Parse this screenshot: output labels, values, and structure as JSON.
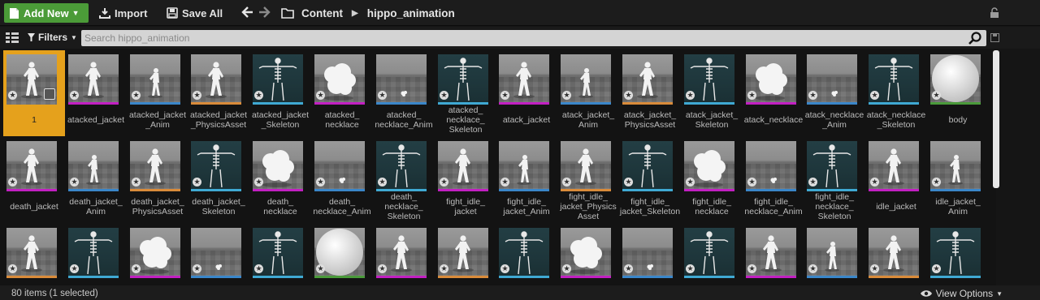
{
  "toolbar": {
    "add_new_label": "Add New",
    "import_label": "Import",
    "save_all_label": "Save All"
  },
  "breadcrumb": [
    "Content",
    "hippo_animation"
  ],
  "filterbar": {
    "filters_label": "Filters",
    "search_placeholder": "Search hippo_animation"
  },
  "assets": [
    {
      "label": "1",
      "kind": "pose",
      "stripe": "",
      "selected": true
    },
    {
      "label": "atacked_jacket",
      "kind": "pose",
      "stripe": "#c21fc2"
    },
    {
      "label": "atacked_jacket _Anim",
      "kind": "pose-small",
      "stripe": "#3a86c9"
    },
    {
      "label": "atacked_jacket _PhysicsAsset",
      "kind": "pose",
      "stripe": "#d98b3a"
    },
    {
      "label": "atacked_jacket _Skeleton",
      "kind": "skel",
      "stripe": "#3fa9d3"
    },
    {
      "label": "atacked_ necklace",
      "kind": "blob",
      "stripe": "#c21fc2"
    },
    {
      "label": "atacked_ necklace_Anim",
      "kind": "tiny",
      "stripe": "#3a86c9"
    },
    {
      "label": "atacked_ necklace_ Skeleton",
      "kind": "skel",
      "stripe": "#3fa9d3"
    },
    {
      "label": "atack_jacket",
      "kind": "pose",
      "stripe": "#c21fc2"
    },
    {
      "label": "atack_jacket_ Anim",
      "kind": "pose-small",
      "stripe": "#3a86c9"
    },
    {
      "label": "atack_jacket_ PhysicsAsset",
      "kind": "pose",
      "stripe": "#d98b3a"
    },
    {
      "label": "atack_jacket_ Skeleton",
      "kind": "skel",
      "stripe": "#3fa9d3"
    },
    {
      "label": "atack_necklace",
      "kind": "blob",
      "stripe": "#c21fc2"
    },
    {
      "label": "atack_necklace _Anim",
      "kind": "tiny",
      "stripe": "#3a86c9"
    },
    {
      "label": "atack_necklace _Skeleton",
      "kind": "skel",
      "stripe": "#3fa9d3"
    },
    {
      "label": "body",
      "kind": "sphere",
      "stripe": "#4a9a3a"
    },
    {
      "label": "death_jacket",
      "kind": "pose",
      "stripe": "#c21fc2"
    },
    {
      "label": "death_jacket_ Anim",
      "kind": "pose-small",
      "stripe": "#3a86c9"
    },
    {
      "label": "death_jacket_ PhysicsAsset",
      "kind": "pose",
      "stripe": "#d98b3a"
    },
    {
      "label": "death_jacket_ Skeleton",
      "kind": "skel",
      "stripe": "#3fa9d3"
    },
    {
      "label": "death_ necklace",
      "kind": "blob",
      "stripe": "#c21fc2"
    },
    {
      "label": "death_ necklace_Anim",
      "kind": "tiny",
      "stripe": "#3a86c9"
    },
    {
      "label": "death_ necklace_ Skeleton",
      "kind": "skel",
      "stripe": "#3fa9d3"
    },
    {
      "label": "fight_idle_ jacket",
      "kind": "pose",
      "stripe": "#c21fc2"
    },
    {
      "label": "fight_idle_ jacket_Anim",
      "kind": "pose-small",
      "stripe": "#3a86c9"
    },
    {
      "label": "fight_idle_ jacket_Physics Asset",
      "kind": "pose",
      "stripe": "#d98b3a"
    },
    {
      "label": "fight_idle_ jacket_Skeleton",
      "kind": "skel",
      "stripe": "#3fa9d3"
    },
    {
      "label": "fight_idle_ necklace",
      "kind": "blob",
      "stripe": "#c21fc2"
    },
    {
      "label": "fight_idle_ necklace_Anim",
      "kind": "tiny",
      "stripe": "#3a86c9"
    },
    {
      "label": "fight_idle_ necklace_ Skeleton",
      "kind": "skel",
      "stripe": "#3fa9d3"
    },
    {
      "label": "idle_jacket",
      "kind": "pose",
      "stripe": "#c21fc2"
    },
    {
      "label": "idle_jacket_ Anim",
      "kind": "pose-small",
      "stripe": "#3a86c9"
    },
    {
      "label": "",
      "kind": "pose",
      "stripe": "#d98b3a"
    },
    {
      "label": "",
      "kind": "skel",
      "stripe": "#3fa9d3"
    },
    {
      "label": "",
      "kind": "blob",
      "stripe": "#c21fc2"
    },
    {
      "label": "",
      "kind": "tiny",
      "stripe": "#3a86c9"
    },
    {
      "label": "",
      "kind": "skel",
      "stripe": "#3fa9d3"
    },
    {
      "label": "",
      "kind": "sphere",
      "stripe": "#4a9a3a"
    },
    {
      "label": "",
      "kind": "pose",
      "stripe": "#c21fc2"
    },
    {
      "label": "",
      "kind": "pose",
      "stripe": "#d98b3a"
    },
    {
      "label": "",
      "kind": "skel",
      "stripe": "#3fa9d3"
    },
    {
      "label": "",
      "kind": "blob",
      "stripe": "#c21fc2"
    },
    {
      "label": "",
      "kind": "tiny",
      "stripe": "#3a86c9"
    },
    {
      "label": "",
      "kind": "skel",
      "stripe": "#3fa9d3"
    },
    {
      "label": "",
      "kind": "pose",
      "stripe": "#c21fc2"
    },
    {
      "label": "",
      "kind": "pose-small",
      "stripe": "#3a86c9"
    },
    {
      "label": "",
      "kind": "pose",
      "stripe": "#d98b3a"
    },
    {
      "label": "",
      "kind": "skel",
      "stripe": "#3fa9d3"
    }
  ],
  "status": {
    "count_text": "80 items (1 selected)",
    "view_options_label": "View Options"
  },
  "colors": {
    "accent_green": "#4b9b38",
    "selection": "#e5a11c"
  },
  "icons": [
    "add-new-icon",
    "import-icon",
    "save-icon",
    "back-arrow-icon",
    "forward-arrow-icon",
    "folder-icon",
    "lock-icon",
    "view-toggle-icon",
    "filter-icon",
    "search-icon",
    "eye-icon"
  ]
}
